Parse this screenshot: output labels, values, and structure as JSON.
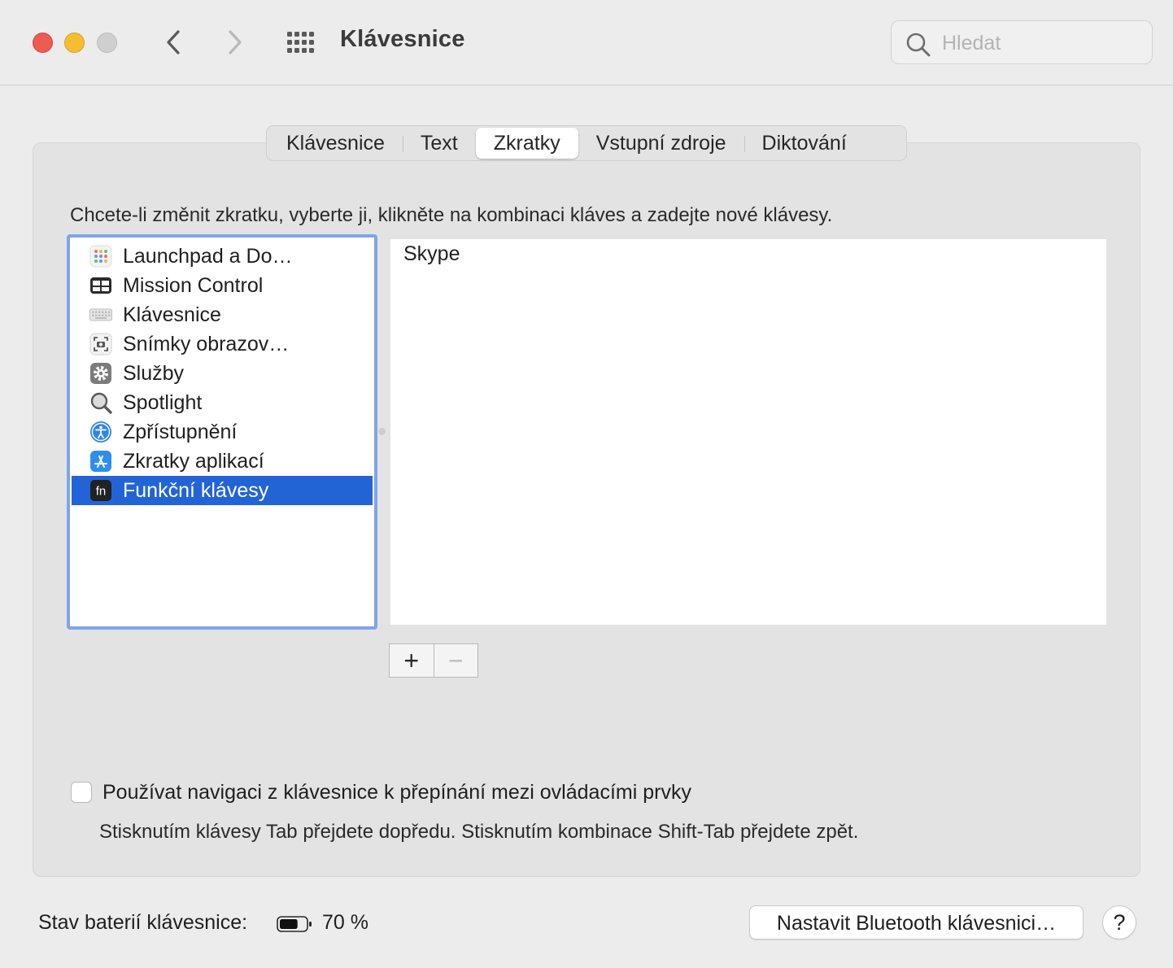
{
  "window": {
    "title": "Klávesnice",
    "search_placeholder": "Hledat"
  },
  "tabs": [
    {
      "label": "Klávesnice"
    },
    {
      "label": "Text"
    },
    {
      "label": "Zkratky",
      "active": true
    },
    {
      "label": "Vstupní zdroje"
    },
    {
      "label": "Diktování"
    }
  ],
  "instruction": "Chcete-li změnit zkratku, vyberte ji, klikněte na kombinaci kláves a zadejte nové klávesy.",
  "categories": [
    {
      "label": "Launchpad a Do…",
      "icon": "launchpad-icon"
    },
    {
      "label": "Mission Control",
      "icon": "mission-control-icon"
    },
    {
      "label": "Klávesnice",
      "icon": "keyboard-icon"
    },
    {
      "label": "Snímky obrazov…",
      "icon": "screenshot-icon"
    },
    {
      "label": "Služby",
      "icon": "gear-icon"
    },
    {
      "label": "Spotlight",
      "icon": "magnifier-icon"
    },
    {
      "label": "Zpřístupnění",
      "icon": "accessibility-icon"
    },
    {
      "label": "Zkratky aplikací",
      "icon": "app-store-icon"
    },
    {
      "label": "Funkční klávesy",
      "icon": "fn-key-icon",
      "selected": true
    }
  ],
  "detail": {
    "items": [
      "Skype"
    ]
  },
  "buttons": {
    "add": "+",
    "remove": "−",
    "bluetooth": "Nastavit Bluetooth klávesnici…",
    "help": "?"
  },
  "keyboard_navigation": {
    "label": "Používat navigaci z klávesnice k přepínání mezi ovládacími prvky",
    "checked": false,
    "hint": "Stisknutím klávesy Tab přejdete dopředu. Stisknutím kombinace Shift-Tab přejdete zpět."
  },
  "battery": {
    "label": "Stav baterií klávesnice:",
    "value": "70 %",
    "level": 0.7
  },
  "colors": {
    "selection": "#2264d6",
    "focus_ring": "#7ea5ea",
    "close": "#ee5b52",
    "minimize": "#f5bd32"
  }
}
